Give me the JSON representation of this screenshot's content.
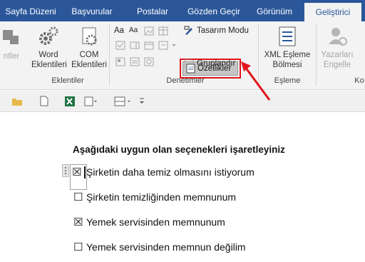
{
  "tabs": [
    "Sayfa Düzeni",
    "Başvurular",
    "Postalar",
    "Gözden Geçir",
    "Görünüm",
    "Geliştirici"
  ],
  "ribbon": {
    "addins": {
      "partial_label": "ntler",
      "word_label": "Word\nEklentileri",
      "com_label": "COM\nEklentileri",
      "group": "Eklentiler"
    },
    "controls": {
      "design_mode": "Tasarım Modu",
      "properties": "Özellikler",
      "group_btn": "Gruplandır",
      "group": "Denetimler"
    },
    "mapping": {
      "xml_label": "XML Eşleme\nBölmesi",
      "group": "Eşleme"
    },
    "protect": {
      "block_label": "Yazarları\nEngelle",
      "group_partial": "Ko"
    }
  },
  "doc": {
    "heading": "Aşağıdaki uygun olan seçenekleri işaretleyiniz",
    "items": [
      {
        "box": "☒",
        "text": "Şirketin daha temiz olmasını istiyorum"
      },
      {
        "box": "☐",
        "text": "Şirketin temizliğinden memnunum"
      },
      {
        "box": "☒",
        "text": "Yemek servisinden memnunum"
      },
      {
        "box": "☐",
        "text": "Yemek servisinden memnun değilim"
      }
    ]
  },
  "colors": {
    "tabbar": "#2b579a",
    "highlight": "#e0161c",
    "ribbon": "#f3f3f3"
  }
}
